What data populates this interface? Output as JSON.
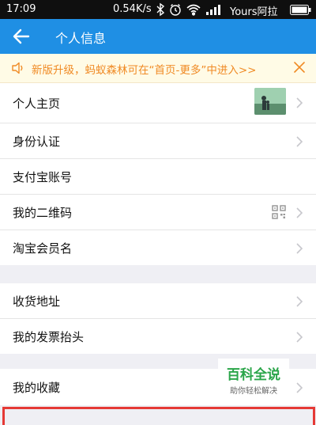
{
  "status_bar": {
    "time": "17:09",
    "speed": "0.54K/s",
    "carrier": "Yours阿拉",
    "icons": [
      "bluetooth-icon",
      "alarm-icon",
      "wifi-icon",
      "signal-icon",
      "battery-icon"
    ]
  },
  "nav": {
    "title": "个人信息",
    "back_icon": "arrow-left-icon",
    "background": "#1f8fe4"
  },
  "notice": {
    "text": "新版升级，蚂蚁森林可在“首页-更多”中进入>>",
    "color": "#f08a24",
    "icons": [
      "speaker-icon",
      "close-icon"
    ]
  },
  "groups": [
    {
      "items": [
        {
          "label": "个人主页",
          "accessory": "avatar"
        },
        {
          "label": "身份认证"
        },
        {
          "label": "支付宝账号"
        },
        {
          "label": "我的二维码",
          "accessory": "qr-code-icon"
        },
        {
          "label": "淘宝会员名"
        }
      ]
    },
    {
      "items": [
        {
          "label": "收货地址"
        },
        {
          "label": "我的发票抬头"
        }
      ]
    },
    {
      "items": [
        {
          "label": "我的收藏"
        }
      ]
    }
  ],
  "watermark": {
    "title": "百科全说",
    "subtitle": "助你轻松解决"
  }
}
